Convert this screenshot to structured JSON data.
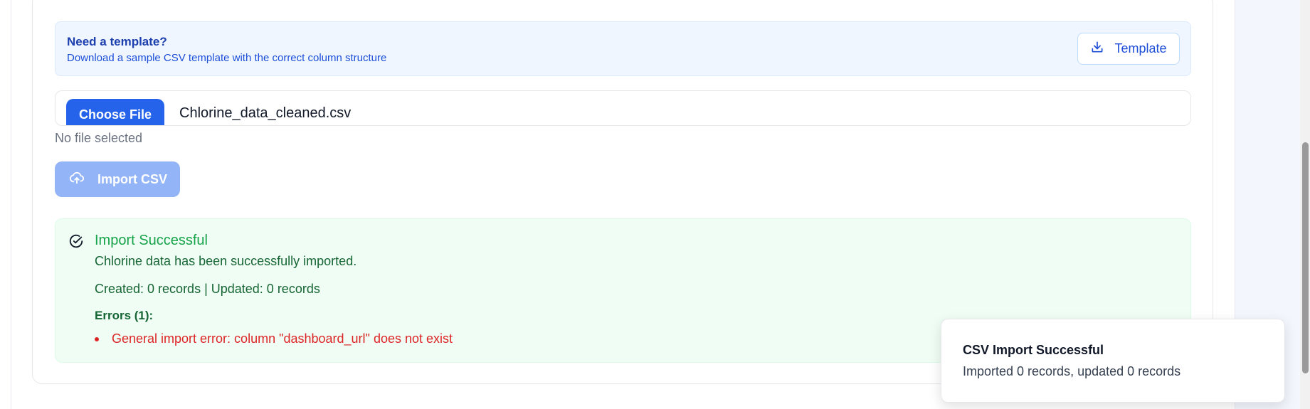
{
  "template": {
    "title": "Need a template?",
    "description": "Download a sample CSV template with the correct column structure",
    "button_label": "Template"
  },
  "file_input": {
    "choose_label": "Choose File",
    "file_name": "Chlorine_data_cleaned.csv",
    "status": "No file selected"
  },
  "import_button": {
    "label": "Import CSV"
  },
  "result": {
    "title": "Import Successful",
    "message": "Chlorine data has been successfully imported.",
    "stats": "Created: 0 records | Updated: 0 records",
    "errors_title": "Errors (1):",
    "errors": [
      "General import error: column \"dashboard_url\" does not exist"
    ]
  },
  "toast": {
    "title": "CSV Import Successful",
    "description": "Imported 0 records, updated 0 records"
  },
  "icons": {
    "download": "download-icon",
    "cloud_upload": "cloud-upload-icon",
    "check_circle": "check-circle-icon"
  },
  "colors": {
    "primary": "#2563eb",
    "success": "#16a34a",
    "error": "#dc2626"
  }
}
